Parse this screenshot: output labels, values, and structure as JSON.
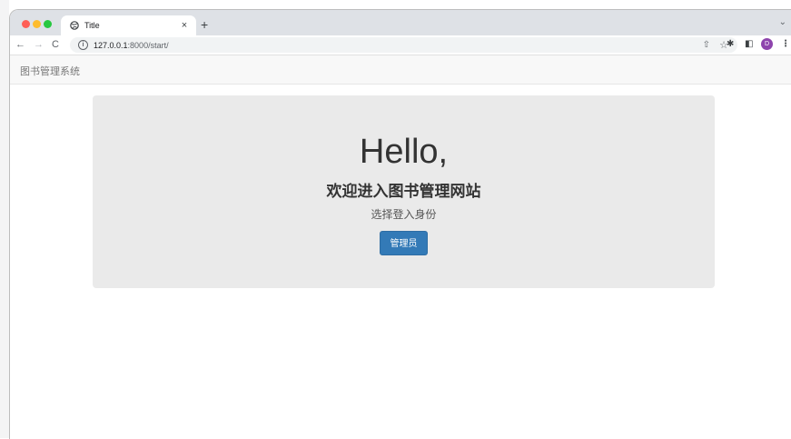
{
  "browser": {
    "tab": {
      "title": "Title",
      "icon": "globe-icon",
      "close": "×"
    },
    "new_tab": "+",
    "address": {
      "host": "127.0.0.1",
      "path": ":8000/start/"
    },
    "profile_initial": "D"
  },
  "navbar": {
    "brand": "图书管理系统"
  },
  "jumbotron": {
    "heading": "Hello,",
    "subheading": "欢迎进入图书管理网站",
    "prompt": "选择登入身份",
    "button_label": "管理员"
  },
  "colors": {
    "primary": "#337ab7",
    "jumbotron_bg": "#eaeaea",
    "navbar_bg": "#f8f8f8"
  }
}
